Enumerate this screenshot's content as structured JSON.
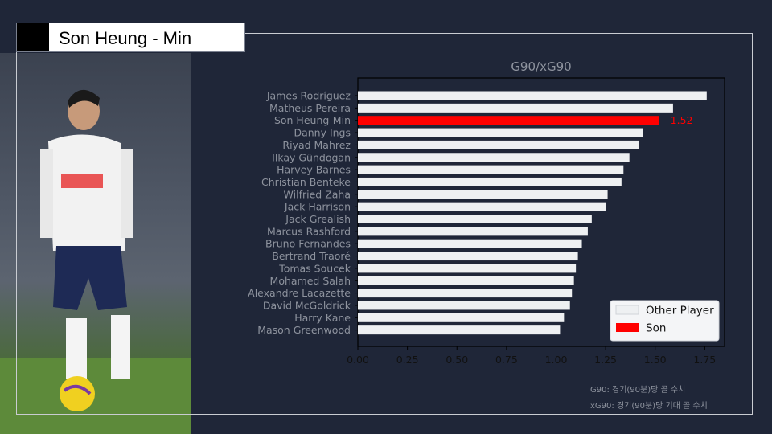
{
  "header": {
    "title": "Son Heung - Min"
  },
  "notes": {
    "g90": "G90: 경기(90분)당 골 수치",
    "xg90": "xG90: 경기(90분)당  기대 골 수치"
  },
  "colors": {
    "other": "#eef0f2",
    "highlight": "#ff0000",
    "axis_text": "#8e939e",
    "tick_text": "#111111"
  },
  "chart_data": {
    "type": "bar",
    "orientation": "horizontal",
    "title": "G90/xG90",
    "categories": [
      "James Rodríguez",
      "Matheus Pereira",
      "Son Heung-Min",
      "Danny Ings",
      "Riyad Mahrez",
      "Ilkay Gündogan",
      "Harvey Barnes",
      "Christian Benteke",
      "Wilfried Zaha",
      "Jack Harrison",
      "Jack Grealish",
      "Marcus Rashford",
      "Bruno Fernandes",
      "Bertrand Traoré",
      "Tomas Soucek",
      "Mohamed Salah",
      "Alexandre Lacazette",
      "David McGoldrick",
      "Harry Kane",
      "Mason Greenwood"
    ],
    "values": [
      1.76,
      1.59,
      1.52,
      1.44,
      1.42,
      1.37,
      1.34,
      1.33,
      1.26,
      1.25,
      1.18,
      1.16,
      1.13,
      1.11,
      1.1,
      1.09,
      1.08,
      1.07,
      1.04,
      1.02
    ],
    "highlight_index": 2,
    "highlight_label": "1.52",
    "xlim": [
      0,
      1.85
    ],
    "xticks": [
      "0.00",
      "0.25",
      "0.50",
      "0.75",
      "1.00",
      "1.25",
      "1.50",
      "1.75"
    ],
    "xtick_values": [
      0,
      0.25,
      0.5,
      0.75,
      1.0,
      1.25,
      1.5,
      1.75
    ],
    "legend": {
      "placement": "lower-right",
      "entries": [
        {
          "label": "Other Player",
          "color": "#eef0f2"
        },
        {
          "label": "Son",
          "color": "#ff0000"
        }
      ]
    }
  }
}
